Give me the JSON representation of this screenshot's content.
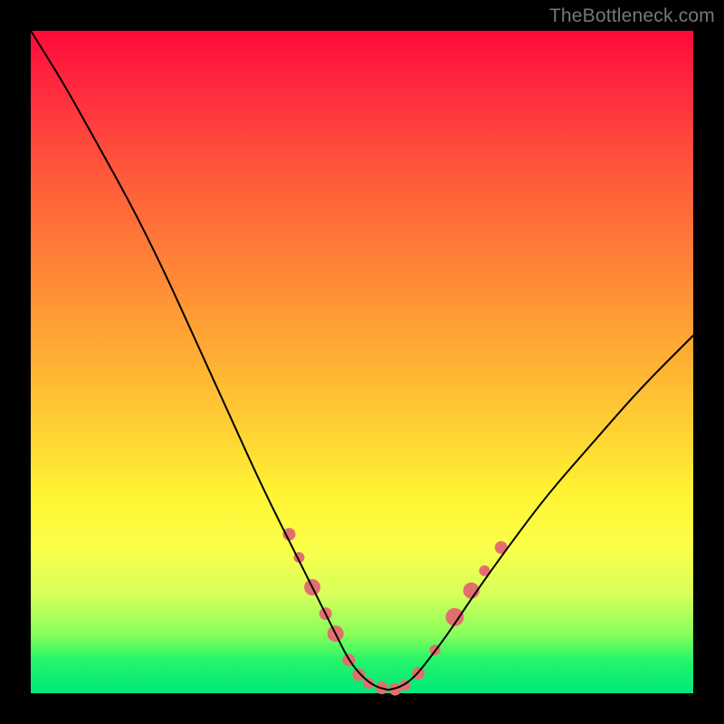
{
  "watermark": "TheBottleneck.com",
  "chart_data": {
    "type": "line",
    "title": "",
    "xlabel": "",
    "ylabel": "",
    "xlim": [
      0,
      100
    ],
    "ylim": [
      0,
      100
    ],
    "grid": false,
    "legend": false,
    "series": [
      {
        "name": "curve-left",
        "x": [
          0,
          5,
          10,
          15,
          20,
          25,
          30,
          35,
          40,
          43,
          46,
          48,
          50,
          52,
          54
        ],
        "y": [
          100,
          92,
          83,
          74,
          64,
          53,
          42,
          31,
          21,
          15,
          9,
          5,
          2.5,
          1,
          0.5
        ],
        "color": "#000000",
        "lw": 2
      },
      {
        "name": "curve-right",
        "x": [
          54,
          56,
          58,
          60,
          63,
          67,
          72,
          78,
          85,
          92,
          100
        ],
        "y": [
          0.5,
          1,
          2.5,
          5,
          9,
          15,
          22,
          30,
          38,
          46,
          54
        ],
        "color": "#000000",
        "lw": 2
      }
    ],
    "markers": [
      {
        "x": 39.0,
        "y": 24.0,
        "r": 7,
        "color": "#e26f6f"
      },
      {
        "x": 40.5,
        "y": 20.5,
        "r": 6,
        "color": "#e26f6f"
      },
      {
        "x": 42.5,
        "y": 16.0,
        "r": 9,
        "color": "#e26f6f"
      },
      {
        "x": 44.5,
        "y": 12.0,
        "r": 7,
        "color": "#e26f6f"
      },
      {
        "x": 46.0,
        "y": 9.0,
        "r": 9,
        "color": "#e26f6f"
      },
      {
        "x": 48.0,
        "y": 5.0,
        "r": 7,
        "color": "#e26f6f"
      },
      {
        "x": 49.5,
        "y": 2.8,
        "r": 7,
        "color": "#e26f6f"
      },
      {
        "x": 51.0,
        "y": 1.5,
        "r": 6,
        "color": "#e26f6f"
      },
      {
        "x": 53.0,
        "y": 0.8,
        "r": 7,
        "color": "#e26f6f"
      },
      {
        "x": 55.0,
        "y": 0.6,
        "r": 7,
        "color": "#e26f6f"
      },
      {
        "x": 56.5,
        "y": 1.2,
        "r": 6,
        "color": "#e26f6f"
      },
      {
        "x": 58.5,
        "y": 3.0,
        "r": 7,
        "color": "#e26f6f"
      },
      {
        "x": 61.0,
        "y": 6.5,
        "r": 6,
        "color": "#e26f6f"
      },
      {
        "x": 64.0,
        "y": 11.5,
        "r": 10,
        "color": "#e26f6f"
      },
      {
        "x": 66.5,
        "y": 15.5,
        "r": 9,
        "color": "#e26f6f"
      },
      {
        "x": 68.5,
        "y": 18.5,
        "r": 6,
        "color": "#e26f6f"
      },
      {
        "x": 71.0,
        "y": 22.0,
        "r": 7,
        "color": "#e26f6f"
      }
    ],
    "gradient_stops": [
      {
        "pos": 0,
        "color": "#ff0a3a"
      },
      {
        "pos": 22,
        "color": "#ff5a3a"
      },
      {
        "pos": 52,
        "color": "#ffb733"
      },
      {
        "pos": 78,
        "color": "#fbff4a"
      },
      {
        "pos": 95,
        "color": "#25f56a"
      },
      {
        "pos": 100,
        "color": "#00e87a"
      }
    ]
  }
}
